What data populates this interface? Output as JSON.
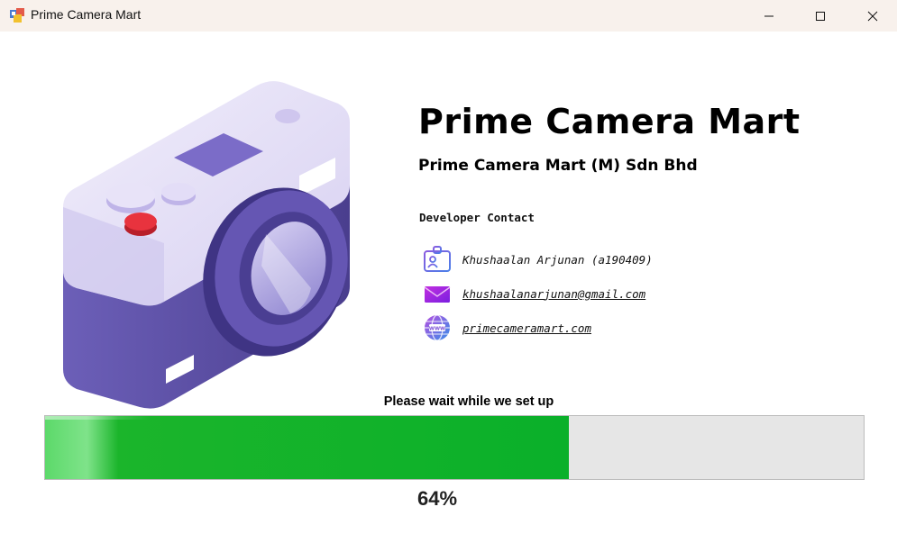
{
  "window": {
    "title": "Prime Camera Mart",
    "icon": "app-window-icon",
    "controls": [
      "minimize-icon",
      "maximize-icon",
      "close-icon"
    ]
  },
  "company": {
    "name": "Prime Camera Mart",
    "legal_name": "Prime Camera Mart (M) Sdn Bhd"
  },
  "contact": {
    "heading": "Developer Contact",
    "name": "Khushaalan Arjunan (a190409)",
    "email": "khushaalanarjunan@gmail.com",
    "website": "primecameramart.com"
  },
  "progress": {
    "label": "Please wait while we set up",
    "value": 64,
    "value_text": "64%",
    "fill_color": "#0ab02a"
  }
}
